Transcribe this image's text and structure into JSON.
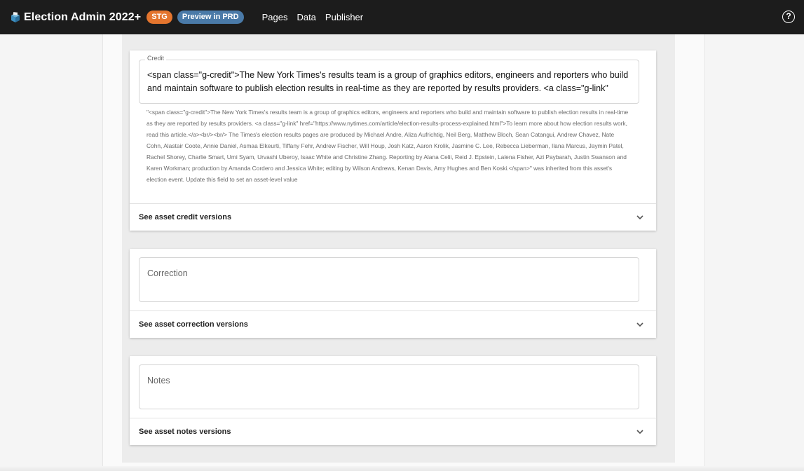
{
  "header": {
    "title": "Election Admin 2022+",
    "badges": [
      {
        "label": "STG",
        "color": "#e4752e"
      },
      {
        "label": "Preview in PRD",
        "color": "#4a7aa8"
      }
    ],
    "nav": [
      "Pages",
      "Data",
      "Publisher"
    ],
    "help_icon": "help-circle-icon"
  },
  "credit": {
    "legend": "Credit",
    "value": "<span class=\"g-credit\">The New York Times's results team is a group of graphics editors, engineers and reporters who build and maintain software to publish election results in real-time as they are reported by results providers. <a class=\"g-link\"",
    "helper": "\"<span class=\"g-credit\">The New York Times's results team is a group of graphics editors, engineers and reporters who build and maintain software to publish election results in real-time as they are reported by results providers. <a class=\"g-link\" href=\"https://www.nytimes.com/article/election-results-process-explained.html\">To learn more about how election results work, read this article.</a><br/><br/> The Times's election results pages are produced by Michael Andre, Aliza Aufrichtig, Neil Berg, Matthew Bloch, Sean Catangui, Andrew Chavez, Nate Cohn, Alastair Coote, Annie Daniel, Asmaa Elkeurti, Tiffany Fehr, Andrew Fischer, Will Houp, Josh Katz, Aaron Krolik, Jasmine C. Lee, Rebecca Lieberman, Ilana Marcus, Jaymin Patel, Rachel Shorey, Charlie Smart, Umi Syam, Urvashi Uberoy, Isaac White and Christine Zhang. Reporting by Alana Celii, Reid J. Epstein, Lalena Fisher, Azi Paybarah, Justin Swanson and Karen Workman; production by Amanda Cordero and Jessica White; editing by Wilson Andrews, Kenan Davis, Amy Hughes and Ben Koski.</span>\" was inherited from this asset's election event. Update this field to set an asset-level value",
    "versions_label": "See asset credit versions"
  },
  "correction": {
    "placeholder": "Correction",
    "versions_label": "See asset correction versions"
  },
  "notes": {
    "placeholder": "Notes",
    "versions_label": "See asset notes versions"
  }
}
